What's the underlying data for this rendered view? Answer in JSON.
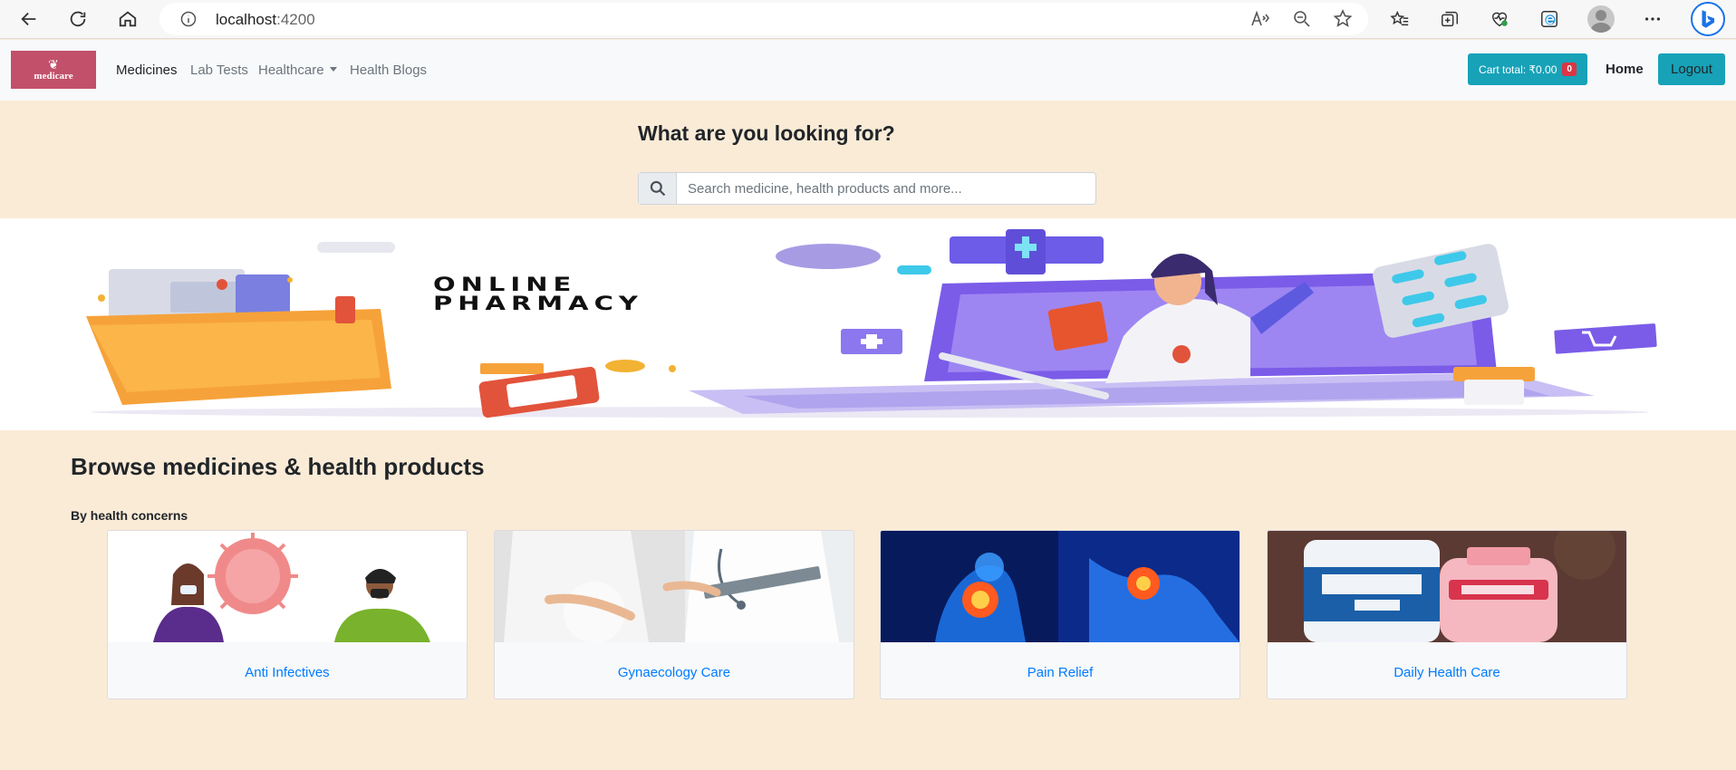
{
  "browser": {
    "url_host": "localhost",
    "url_port": ":4200",
    "icons": [
      "back-icon",
      "reload-icon",
      "home-icon",
      "site-info-icon",
      "read-aloud-icon",
      "zoom-out-icon",
      "add-favorite-icon",
      "favorites-icon",
      "collections-icon",
      "browser-essentials-icon",
      "edge-icon",
      "profile-icon",
      "more-icon",
      "bing-copilot-icon"
    ]
  },
  "navbar": {
    "logo_text": "medicare",
    "links": [
      "Medicines",
      "Lab Tests",
      "Healthcare",
      "Health Blogs"
    ],
    "cart_label": "Cart total: ₹0.00",
    "cart_count": "0",
    "home_label": "Home",
    "logout_label": "Logout",
    "accent_color": "#17a2b8",
    "badge_color": "#dc3545"
  },
  "search": {
    "heading": "What are you looking for?",
    "placeholder": "Search medicine, health products and more..."
  },
  "banner": {
    "title_line1": "ONLINE",
    "title_line2": "PHARMACY"
  },
  "browse": {
    "heading": "Browse medicines & health products",
    "subheading": "By health concerns",
    "categories": [
      "Anti Infectives",
      "Gynaecology Care",
      "Pain Relief",
      "Daily Health Care"
    ]
  },
  "colors": {
    "page_background": "#faebd7",
    "link_blue": "#007bff",
    "logo_bg": "#c2506a"
  }
}
